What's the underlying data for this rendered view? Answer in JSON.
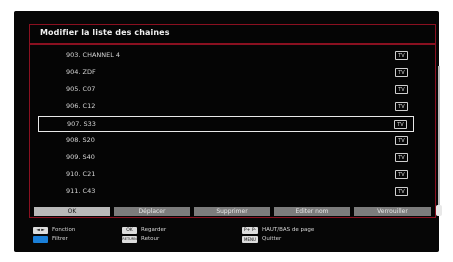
{
  "title": "Modifier la liste des chaines",
  "channels": [
    {
      "label": "903. CHANNEL 4",
      "badge": "TV"
    },
    {
      "label": "904. ZDF",
      "badge": "TV"
    },
    {
      "label": "905. C07",
      "badge": "TV"
    },
    {
      "label": "906. C12",
      "badge": "TV"
    },
    {
      "label": "907. S33",
      "badge": "TV",
      "selected": true
    },
    {
      "label": "908. S20",
      "badge": "TV"
    },
    {
      "label": "909. S40",
      "badge": "TV"
    },
    {
      "label": "910. C21",
      "badge": "TV"
    },
    {
      "label": "911. C43",
      "badge": "TV"
    }
  ],
  "buttons": [
    {
      "label": "OK",
      "active": true
    },
    {
      "label": "Déplacer"
    },
    {
      "label": "Supprimer"
    },
    {
      "label": "Editer nom"
    },
    {
      "label": "Verrouiller"
    }
  ],
  "legend": {
    "function_key": "◄ ►",
    "function_label": "Fonction",
    "filter_label": "Filtrer",
    "ok_key": "OK",
    "ok_label": "Regarder",
    "return_key": "RETURN",
    "return_label": "Retour",
    "page_key": "P+ P-",
    "page_label": "HAUT/BAS de page",
    "menu_key": "MENU",
    "menu_label": "Quitter"
  },
  "colors": {
    "frame_red": "#8a1020",
    "button_gray": "#7c7c7c",
    "button_active": "#b9b9b9",
    "blue_key": "#1a7fd8"
  }
}
